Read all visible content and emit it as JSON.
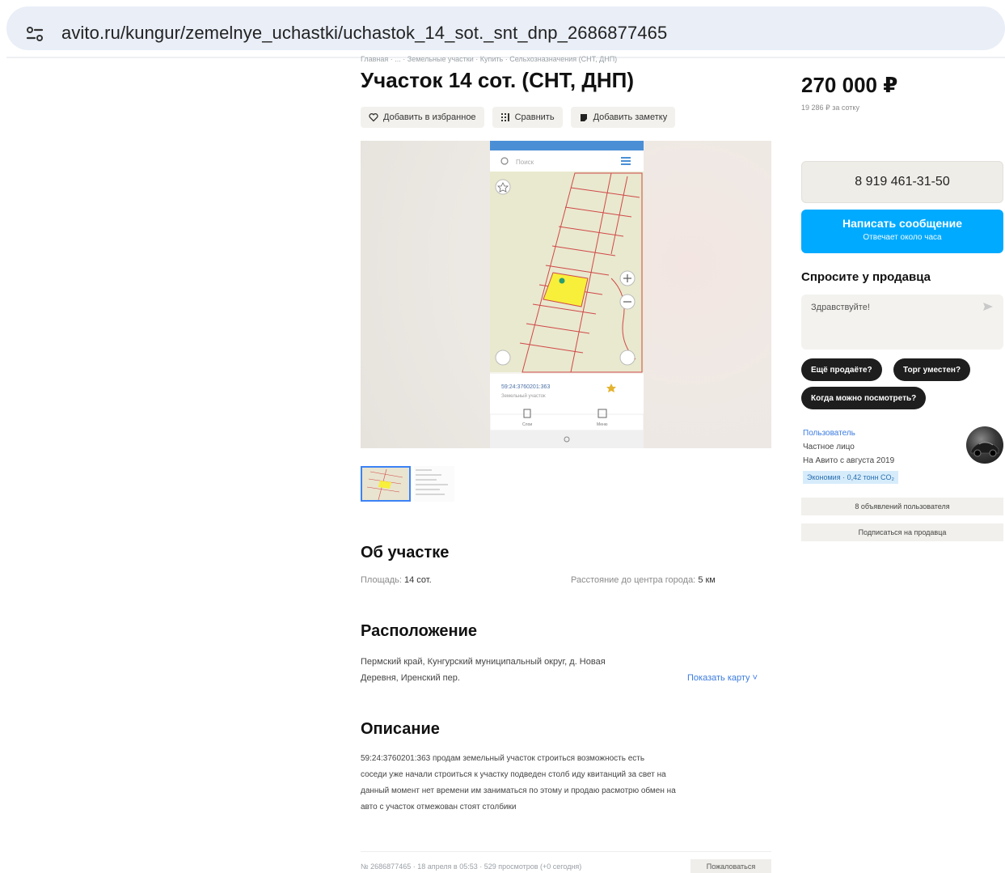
{
  "browser": {
    "url": "avito.ru/kungur/zemelnye_uchastki/uchastok_14_sot._snt_dnp_2686877465"
  },
  "breadcrumb": "Главная · ... · Земельные участки · Купить · Сельхозназначения (СНТ, ДНП)",
  "title": "Участок 14 сот. (СНТ, ДНП)",
  "actions": {
    "favorite": "Добавить в избранное",
    "compare": "Сравнить",
    "note": "Добавить заметку"
  },
  "map_screenshot": {
    "search_placeholder": "Поиск",
    "parcel_number": "59:24:3760201:363",
    "parcel_sub": "Земельный участок",
    "tab_left": "Слои",
    "tab_right": "Меню"
  },
  "about": {
    "title": "Об участке",
    "area_label": "Площадь:",
    "area_value": "14 сот.",
    "distance_label": "Расстояние до центра города:",
    "distance_value": "5 км"
  },
  "location": {
    "title": "Расположение",
    "address_line1": "Пермский край, Кунгурский муниципальный округ, д. Новая",
    "address_line2": "Деревня, Иренский пер.",
    "map_link": "Показать карту ˅"
  },
  "description": {
    "title": "Описание",
    "line1": "59:24:3760201:363 продам земельный участок строиться возможность есть",
    "line2": "соседи уже начали строиться к участку подведен столб иду квитанций за свет на",
    "line3": "данный момент нет времени им заниматься по этому и продаю расмотрю обмен на",
    "line4": "авто с участок отмежован стоят столбики"
  },
  "footer": {
    "meta": "№ 2686877465 · 18 апреля в 05:53 · 529 просмотров (+0 сегодня)",
    "complain": "Пожаловаться"
  },
  "sidebar": {
    "price": "270 000 ₽",
    "price_per": "19 286 ₽ за сотку",
    "phone": "8 919 461-31-50",
    "message_main": "Написать сообщение",
    "message_sub": "Отвечает около часа",
    "ask_title": "Спросите у продавца",
    "ask_placeholder": "Здравствуйте!",
    "chips": [
      "Ещё продаёте?",
      "Торг уместен?",
      "Когда можно посмотреть?"
    ],
    "seller_name": "Пользователь",
    "seller_type": "Частное лицо",
    "seller_since": "На Авито с августа 2019",
    "eco": "Экономия · 0,42 тонн CO₂",
    "btn_ads": "8 объявлений пользователя",
    "btn_subscribe": "Подписаться на продавца"
  },
  "colors": {
    "accent": "#00aaff",
    "link": "#3b7be0",
    "plot_highlight": "#f7ef3a",
    "plot_lines": "#d04848"
  }
}
